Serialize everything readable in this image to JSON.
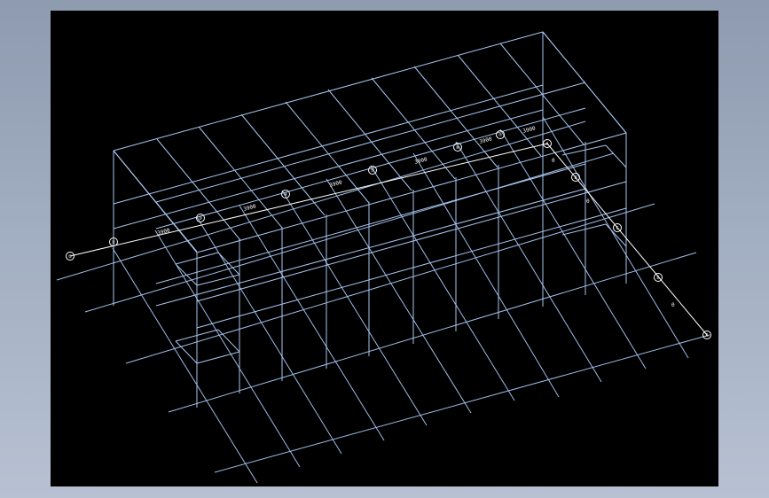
{
  "app": {
    "title": ""
  },
  "viewport": {
    "background": "#000000",
    "line_color": "#a8c6f0",
    "annotation_color": "#ffffff"
  },
  "axis_bubbles_long": [
    "①",
    "②",
    "③",
    "④",
    "⑤",
    "⑥",
    "⑦"
  ],
  "axis_bubbles_short": [
    "A",
    "B",
    "C",
    "D"
  ],
  "dimension_labels_long": [
    "3900",
    "3900",
    "3900",
    "3900",
    "3900",
    "3900"
  ],
  "dimension_labels_short": [
    "0",
    "0",
    "0"
  ]
}
